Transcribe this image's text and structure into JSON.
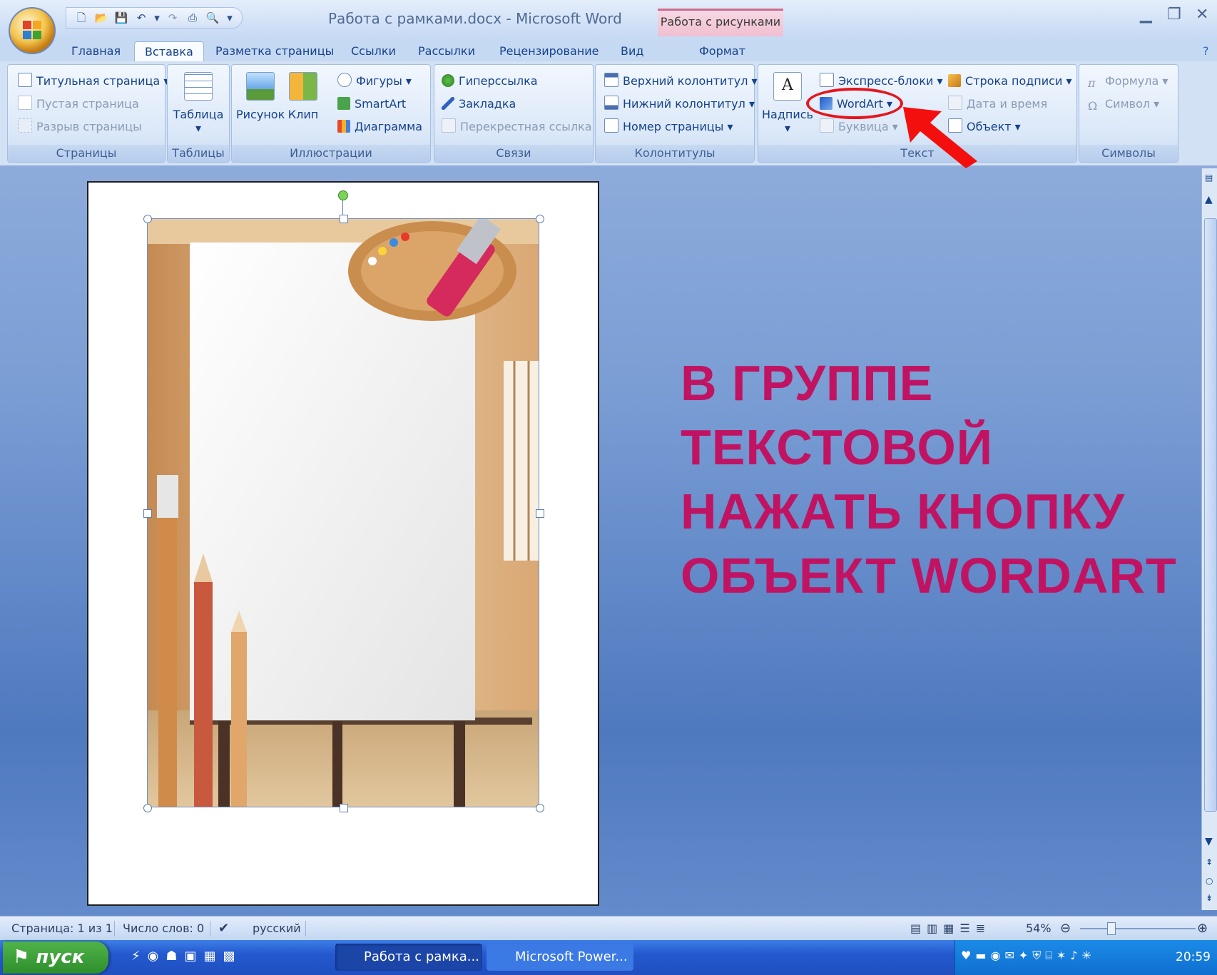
{
  "window": {
    "title": "Работа с рамками.docx - Microsoft Word",
    "contextual_tab": "Работа с рисунками",
    "controls": [
      "minimize-icon",
      "restore-icon",
      "close-icon"
    ]
  },
  "quick_access": [
    "new-icon",
    "open-icon",
    "save-icon",
    "undo-icon",
    "redo-icon",
    "print-icon",
    "print-preview-icon",
    "customize-icon"
  ],
  "tabs": [
    "Главная",
    "Вставка",
    "Разметка страницы",
    "Ссылки",
    "Рассылки",
    "Рецензирование",
    "Вид",
    "Формат"
  ],
  "active_tab": "Вставка",
  "ribbon": {
    "pages": {
      "label": "Страницы",
      "items": [
        "Титульная страница",
        "Пустая страница",
        "Разрыв страницы"
      ]
    },
    "tables": {
      "label": "Таблицы",
      "table": "Таблица"
    },
    "illustrations": {
      "label": "Иллюстрации",
      "picture": "Рисунок",
      "clip": "Клип",
      "shapes": "Фигуры",
      "smartart": "SmartArt",
      "chart": "Диаграмма"
    },
    "links": {
      "label": "Связи",
      "hyperlink": "Гиперссылка",
      "bookmark": "Закладка",
      "crossref": "Перекрестная ссылка"
    },
    "headers": {
      "label": "Колонтитулы",
      "header": "Верхний колонтитул",
      "footer": "Нижний колонтитул",
      "page_number": "Номер страницы"
    },
    "text": {
      "label": "Текст",
      "textbox": "Надпись",
      "quick_parts": "Экспресс-блоки",
      "wordart": "WordArt",
      "dropcap": "Буквица",
      "signature": "Строка подписи",
      "datetime": "Дата и время",
      "object": "Объект"
    },
    "symbols": {
      "label": "Символы",
      "equation": "Формула",
      "symbol": "Символ"
    }
  },
  "annotation": {
    "color": "#e3161e",
    "target": "WordArt"
  },
  "instruction_text": "В ГРУППЕ ТЕКСТОВОЙ НАЖАТЬ КНОПКУ ОБЪЕКТ WORDART",
  "instruction_color": "#c01463",
  "status": {
    "page": "Страница: 1 из 1",
    "words": "Число слов: 0",
    "language": "русский",
    "zoom": "54%",
    "zoom_level": 0.54
  },
  "taskbar": {
    "start": "пуск",
    "tasks": [
      "Работа с рамка...",
      "Microsoft Power..."
    ],
    "clock": "20:59"
  }
}
